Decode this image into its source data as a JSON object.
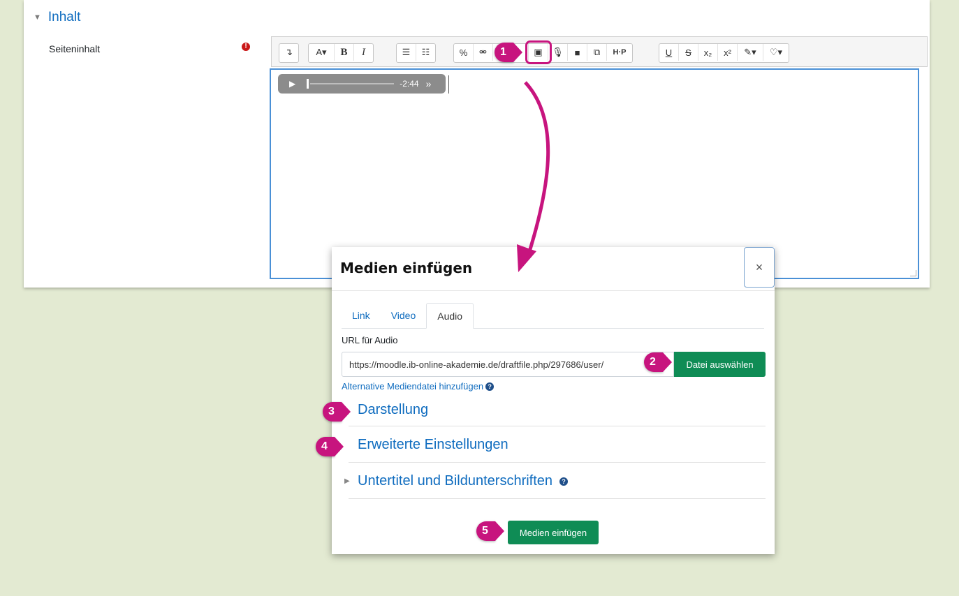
{
  "section": {
    "title": "Inhalt"
  },
  "field": {
    "label": "Seiteninhalt",
    "required_mark": "!"
  },
  "editor": {
    "toolbar_glyphs": {
      "collapse": "↴",
      "font": "A▾",
      "bold": "B",
      "italic": "I",
      "ul": "☰",
      "ol": "☷",
      "link": "%",
      "unlink": "⚮",
      "media": "▣",
      "mic": "🎙",
      "video": "■",
      "copy": "⧉",
      "h5p": "H·P",
      "underline": "U",
      "strike": "S",
      "sub": "x₂",
      "sup": "x²",
      "brush": "✎▾",
      "bulb": "♡▾"
    },
    "audio_time": "-2:44"
  },
  "steps": [
    "1",
    "2",
    "3",
    "4",
    "5"
  ],
  "modal": {
    "title": "Medien einfügen",
    "close": "×",
    "tabs": [
      "Link",
      "Video",
      "Audio"
    ],
    "active_tab": "Audio",
    "url_label": "URL für Audio",
    "url_value": "https://moodle.ib-online-akademie.de/draftfile.php/297686/user/",
    "pick_button": "Datei auswählen",
    "alt_link": "Alternative Mediendatei hinzufügen",
    "help": "?",
    "sections": [
      "Darstellung",
      "Erweiterte Einstellungen",
      "Untertitel und Bildunterschriften"
    ],
    "insert_button": "Medien einfügen"
  },
  "colors": {
    "accent": "#c7147e",
    "link": "#0f6cbf",
    "button": "#0f8c55",
    "background": "#e3ead2"
  }
}
